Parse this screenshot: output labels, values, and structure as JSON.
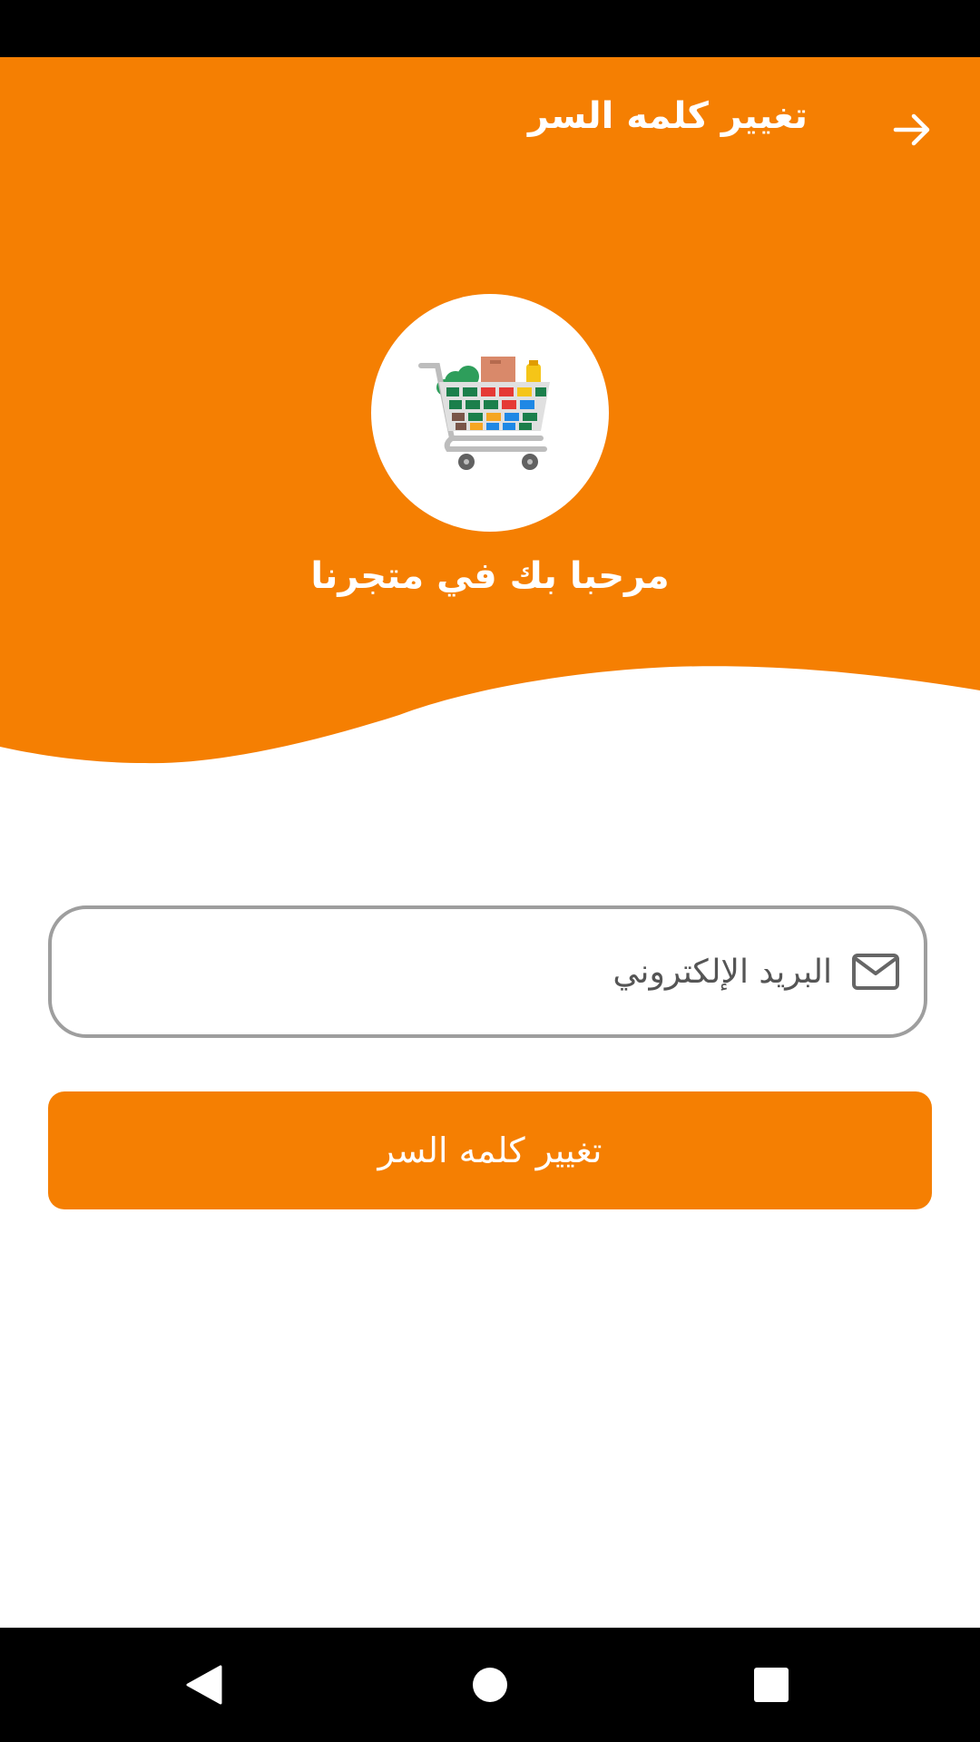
{
  "app_bar": {
    "title": "تغيير كلمه السر",
    "back_icon": "arrow-right-icon"
  },
  "logo": {
    "icon": "shopping-cart-icon"
  },
  "welcome": {
    "text": "مرحبا بك في متجرنا"
  },
  "email_field": {
    "placeholder": "البريد الإلكتروني",
    "value": "",
    "icon": "mail-icon"
  },
  "submit_button": {
    "label": "تغيير كلمه السر"
  },
  "system_nav": {
    "back": "back-triangle-icon",
    "home": "home-circle-icon",
    "recents": "recents-square-icon"
  },
  "colors": {
    "accent": "#f57f02",
    "border": "#9e9e9e",
    "system_bars": "#000000"
  }
}
